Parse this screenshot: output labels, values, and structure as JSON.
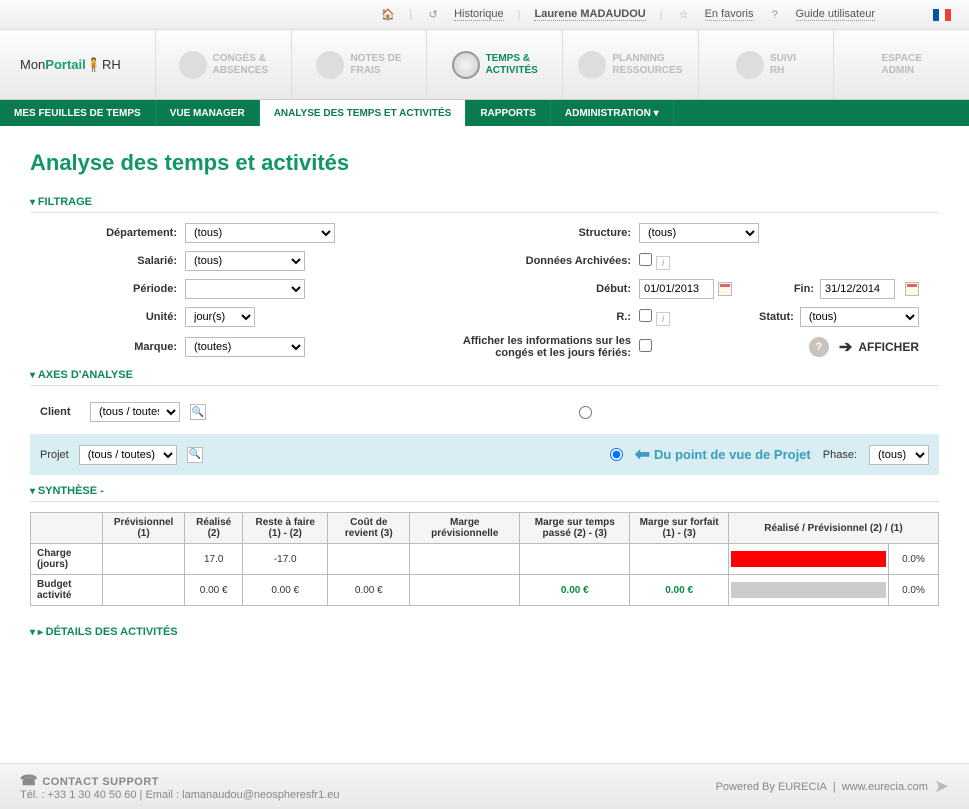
{
  "top": {
    "historique": "Historique",
    "user": "Laurene MADAUDOU",
    "favoris": "En favoris",
    "guide": "Guide utilisateur"
  },
  "logo": {
    "mon": "Mon",
    "portail": "Portail",
    "rh": "RH"
  },
  "modules": [
    {
      "l1": "CONGÉS &",
      "l2": "ABSENCES"
    },
    {
      "l1": "NOTES DE",
      "l2": "FRAIS"
    },
    {
      "l1": "TEMPS &",
      "l2": "ACTIVITÉS"
    },
    {
      "l1": "PLANNING",
      "l2": "RESSOURCES"
    },
    {
      "l1": "SUIVI",
      "l2": "RH"
    },
    {
      "l1": "ESPACE",
      "l2": "ADMIN"
    }
  ],
  "subnav": [
    "MES FEUILLES DE TEMPS",
    "VUE MANAGER",
    "ANALYSE DES TEMPS ET ACTIVITÉS",
    "RAPPORTS",
    "ADMINISTRATION ▾"
  ],
  "title": "Analyse des temps et activités",
  "sections": {
    "filtrage": "FILTRAGE",
    "axes": "AXES D'ANALYSE",
    "synthese": "SYNTHÈSE -",
    "details": "DÉTAILS DES ACTIVITÉS"
  },
  "filters": {
    "departement_lbl": "Département:",
    "departement": "(tous)",
    "structure_lbl": "Structure:",
    "structure": "(tous)",
    "salarie_lbl": "Salarié:",
    "salarie": "(tous)",
    "donnees_lbl": "Données Archivées:",
    "periode_lbl": "Période:",
    "periode": "",
    "debut_lbl": "Début:",
    "debut": "01/01/2013",
    "fin_lbl": "Fin:",
    "fin": "31/12/2014",
    "unite_lbl": "Unité:",
    "unite": "jour(s)",
    "r_lbl": "R.:",
    "statut_lbl": "Statut:",
    "statut": "(tous)",
    "marque_lbl": "Marque:",
    "marque": "(toutes)",
    "afficher_info_lbl": "Afficher les informations sur les congés et les jours fériés:",
    "afficher_btn": "AFFICHER"
  },
  "axes": {
    "client_lbl": "Client",
    "client": "(tous / toutes)",
    "projet_lbl": "Projet",
    "projet": "(tous / toutes)",
    "pov": "Du point de vue de Projet",
    "phase_lbl": "Phase:",
    "phase": "(tous)"
  },
  "table": {
    "headers": [
      "",
      "Prévisionnel (1)",
      "Réalisé (2)",
      "Reste à faire (1) - (2)",
      "Coût de revient (3)",
      "Marge prévisionnelle",
      "Marge sur temps passé (2) - (3)",
      "Marge sur forfait (1) - (3)",
      "Réalisé / Prévisionnel (2) / (1)"
    ],
    "rows": [
      {
        "label": "Charge (jours)",
        "prev": "",
        "real": "17.0",
        "reste": "-17.0",
        "cout": "",
        "mprev": "",
        "mtps": "",
        "mforf": "",
        "bar": "red",
        "pct": "0.0%"
      },
      {
        "label": "Budget activité",
        "prev": "",
        "real": "0.00 €",
        "reste": "0.00 €",
        "cout": "0.00 €",
        "mprev": "",
        "mtps": "0.00 €",
        "mforf": "0.00 €",
        "bar": "grey",
        "pct": "0.0%"
      }
    ]
  },
  "footer": {
    "contact": "CONTACT SUPPORT",
    "tel": "Tél. : +33 1 30 40 50 60  |  Email : lamanaudou@neospheresfr1.eu",
    "powered": "Powered By EURECIA",
    "sep": "|",
    "site": "www.eurecia.com"
  }
}
